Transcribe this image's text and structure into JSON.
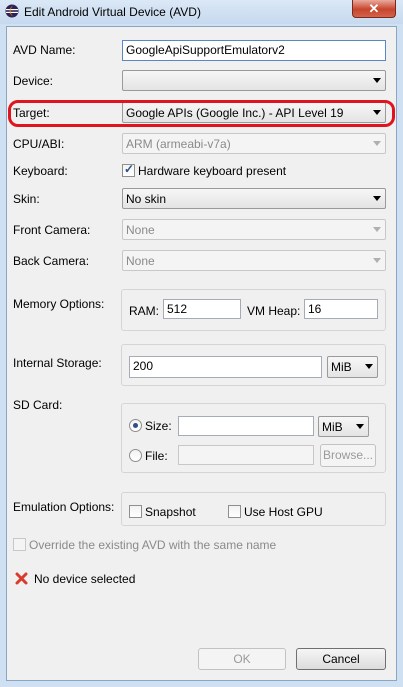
{
  "window": {
    "title": "Edit Android Virtual Device (AVD)",
    "close_label": "✕"
  },
  "form": {
    "avd_name": {
      "label": "AVD Name:",
      "value": "GoogleApiSupportEmulatorv2"
    },
    "device": {
      "label": "Device:",
      "value": ""
    },
    "target": {
      "label": "Target:",
      "value": "Google APIs (Google Inc.) - API Level 19"
    },
    "cpu_abi": {
      "label": "CPU/ABI:",
      "value": "ARM (armeabi-v7a)"
    },
    "keyboard": {
      "label": "Keyboard:",
      "checkbox_label": "Hardware keyboard present",
      "checked": true
    },
    "skin": {
      "label": "Skin:",
      "value": "No skin"
    },
    "front_camera": {
      "label": "Front Camera:",
      "value": "None"
    },
    "back_camera": {
      "label": "Back Camera:",
      "value": "None"
    },
    "memory": {
      "label": "Memory Options:",
      "ram_label": "RAM:",
      "ram_value": "512",
      "vm_heap_label": "VM Heap:",
      "vm_heap_value": "16"
    },
    "internal_storage": {
      "label": "Internal Storage:",
      "value": "200",
      "unit": "MiB"
    },
    "sd_card": {
      "label": "SD Card:",
      "size_label": "Size:",
      "size_value": "",
      "size_unit": "MiB",
      "file_label": "File:",
      "file_value": "",
      "browse_label": "Browse...",
      "selected": "size"
    },
    "emulation": {
      "label": "Emulation Options:",
      "snapshot_label": "Snapshot",
      "host_gpu_label": "Use Host GPU"
    },
    "override": {
      "label": "Override the existing AVD with the same name"
    }
  },
  "status": {
    "message": "No device selected"
  },
  "buttons": {
    "ok": "OK",
    "cancel": "Cancel"
  },
  "colors": {
    "highlight": "#e0141e",
    "error_icon": "#d93b2b"
  }
}
